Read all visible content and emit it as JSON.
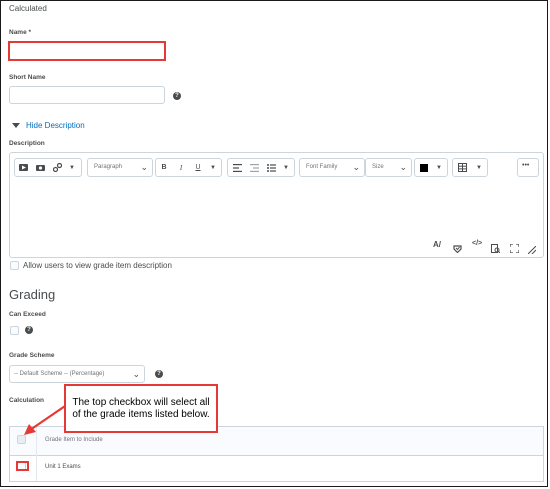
{
  "header": {
    "partial_title": "Calculated"
  },
  "name_field": {
    "label": "Name *",
    "value": ""
  },
  "short_name_field": {
    "label": "Short Name",
    "value": "",
    "help_icon": "question-icon"
  },
  "description_toggle": {
    "label": "Hide Description",
    "icon": "triangle-down-icon"
  },
  "description": {
    "label": "Description",
    "toolbar": {
      "paragraph_select": "Paragraph",
      "bold": "B",
      "italic": "I",
      "underline": "U",
      "font_family_select": "Font Family",
      "size_select": "Size",
      "more": "•••"
    },
    "bottom_icons": [
      "spellcheck-icon",
      "accessibility-icon",
      "source-code-icon",
      "preview-icon",
      "fullscreen-icon",
      "resize-icon"
    ]
  },
  "allow_view_checkbox": {
    "label": "Allow users to view grade item description",
    "checked": false
  },
  "grading": {
    "heading": "Grading",
    "can_exceed_label": "Can Exceed",
    "grade_scheme_label": "Grade Scheme",
    "grade_scheme_value": "-- Default Scheme -- (Percentage)",
    "calculation_label": "Calculation"
  },
  "callout": {
    "text": "The top checkbox will select all of the grade items listed below."
  },
  "grade_table": {
    "header": "Grade Item to Include",
    "rows": [
      {
        "label": "Unit 1 Exams"
      }
    ]
  },
  "colors": {
    "annotation_red": "#e53935",
    "link_blue": "#006fbf",
    "border": "#cdd5dc"
  }
}
